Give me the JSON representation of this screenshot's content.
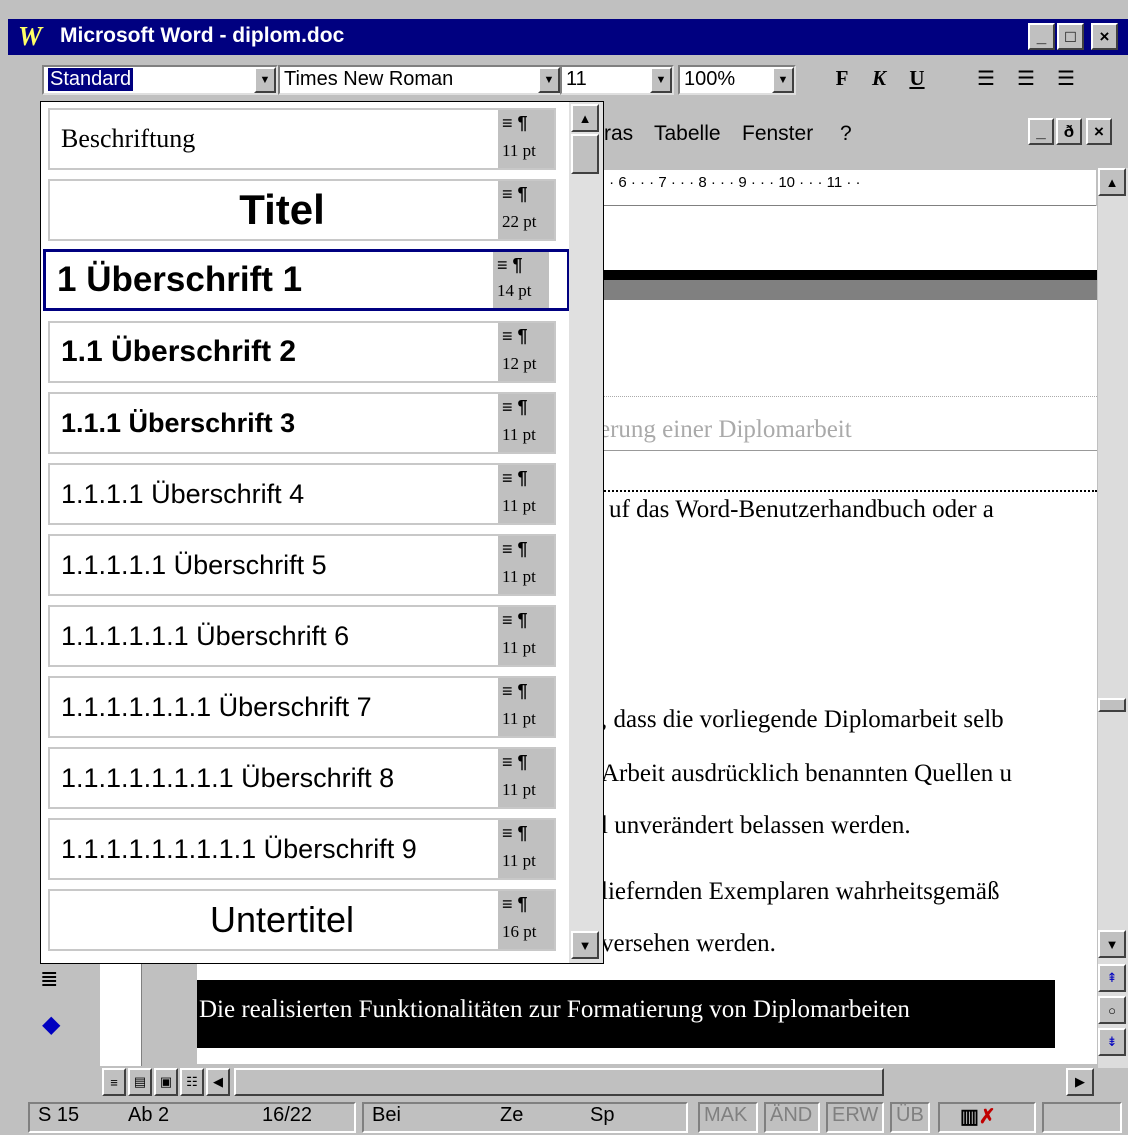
{
  "window": {
    "title": "Microsoft Word - diplom.doc",
    "app_icon": "W",
    "minimize": "_",
    "maximize": "□",
    "close": "×"
  },
  "formatting": {
    "style": "Standard",
    "font": "Times New Roman",
    "size": "11",
    "zoom": "100%",
    "bold": "F",
    "italic": "K",
    "underline": "U"
  },
  "menu": {
    "extras_partial": "ras",
    "table": "Tabelle",
    "window": "Fenster",
    "help": "?"
  },
  "doc_window": {
    "minimize": "_",
    "restore": "ð",
    "close": "×"
  },
  "ruler": {
    "text": "· · 6 · · · 7 · · · 8 · · · 9 · · · 10 · · · 11 · ·"
  },
  "style_list": [
    {
      "name": "Beschriftung",
      "size": "11 pt"
    },
    {
      "name": "Titel",
      "size": "22 pt"
    },
    {
      "name": "1  Überschrift 1",
      "size": "14 pt"
    },
    {
      "name": "1.1  Überschrift 2",
      "size": "12 pt"
    },
    {
      "name": "1.1.1  Überschrift 3",
      "size": "11 pt"
    },
    {
      "name": "1.1.1.1  Überschrift 4",
      "size": "11 pt"
    },
    {
      "name": "1.1.1.1.1  Überschrift 5",
      "size": "11 pt"
    },
    {
      "name": "1.1.1.1.1.1  Überschrift 6",
      "size": "11 pt"
    },
    {
      "name": "1.1.1.1.1.1.1  Überschrift 7",
      "size": "11 pt"
    },
    {
      "name": "1.1.1.1.1.1.1.1  Überschrift 8",
      "size": "11 pt"
    },
    {
      "name": "1.1.1.1.1.1.1.1.1  Überschrift 9",
      "size": "11 pt"
    },
    {
      "name": "Untertitel",
      "size": "16 pt"
    }
  ],
  "document": {
    "line1": "erung einer Diplomarbeit",
    "line2": "uf das Word-Benutzerhandbuch oder a",
    "line3": ", dass die vorliegende Diplomarbeit selb",
    "line4": "Arbeit ausdrücklich benannten Quellen u",
    "line5": "l unverändert belassen werden.",
    "line6": "liefernden Exemplaren wahrheitsgemäß",
    "line7": "versehen werden.",
    "highlight": "Die realisierten Funktionalitäten zur Formatierung von Diplomarbeiten"
  },
  "status": {
    "page": "S 15",
    "section": "Ab 2",
    "pages": "16/22",
    "at": "Bei",
    "line": "Ze",
    "col": "Sp",
    "mak": "MAK",
    "and": "ÄND",
    "erw": "ERW",
    "ub": "ÜB"
  }
}
